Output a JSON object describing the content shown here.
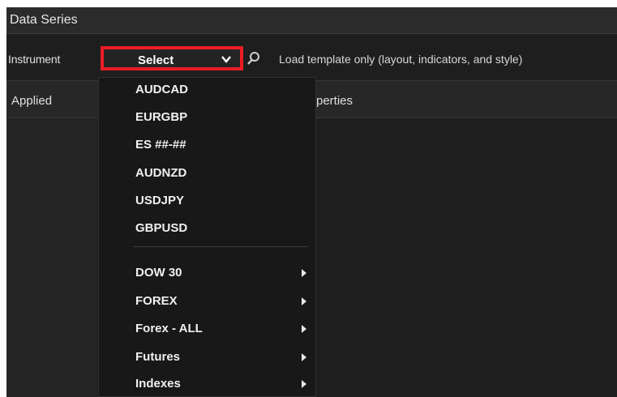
{
  "window": {
    "title": "Data Series"
  },
  "toolbar": {
    "instrument_label": "Instrument",
    "select_value": "Select",
    "template_label": "Load template only (layout, indicators, and style)"
  },
  "panel": {
    "applied_header": "Applied",
    "properties_header_visible": "perties"
  },
  "dropdown": {
    "recent_items": [
      {
        "label": "AUDCAD"
      },
      {
        "label": "EURGBP"
      },
      {
        "label": "ES ##-##"
      },
      {
        "label": "AUDNZD"
      },
      {
        "label": "USDJPY"
      },
      {
        "label": "GBPUSD"
      }
    ],
    "list_items": [
      {
        "label": "DOW 30"
      },
      {
        "label": "FOREX"
      },
      {
        "label": "Forex - ALL"
      },
      {
        "label": "Futures"
      },
      {
        "label": "Indexes"
      }
    ]
  },
  "colors": {
    "highlight_border": "#ec1c24",
    "background": "#1e1e1e",
    "menu_background": "#181818"
  },
  "icons": {
    "select_chevron": "chevron-down-icon",
    "search": "search-icon",
    "submenu": "chevron-right-icon"
  }
}
